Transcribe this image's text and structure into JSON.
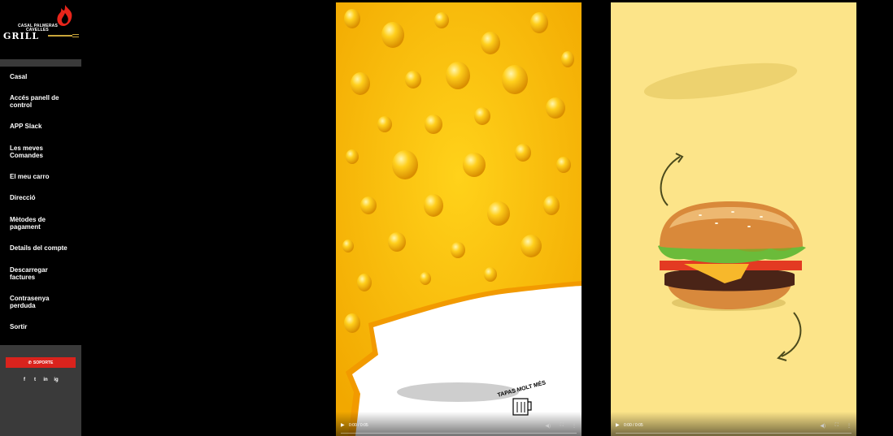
{
  "logo": {
    "line1": "CASAL PALMERAS",
    "line2": "CAVELLES",
    "grill": "GRILL"
  },
  "sidebar": {
    "items": [
      {
        "label": "Casal"
      },
      {
        "label": "Accés panell de control"
      },
      {
        "label": "APP Slack"
      },
      {
        "label": "Les meves Comandes"
      },
      {
        "label": "El meu carro"
      },
      {
        "label": "Direcció"
      },
      {
        "label": "Mètodes de pagament"
      },
      {
        "label": "Details del compte"
      },
      {
        "label": "Descarregar factures"
      },
      {
        "label": "Contrasenya perduda"
      },
      {
        "label": "Sortir"
      }
    ],
    "support_label": "SOPORTE",
    "socials": [
      "f",
      "t",
      "in",
      "ig"
    ]
  },
  "videos": [
    {
      "time": "0:00 / 0:05",
      "overlay_text": "TAPAS MOLT MÉS"
    },
    {
      "time": "0:00 / 0:05"
    }
  ],
  "colors": {
    "sidebar_bg": "#000000",
    "sidebar_panel": "#3a3a3a",
    "support_red": "#d9231d",
    "beer_yellow": "#f7b800",
    "burger_bg": "#fce489"
  }
}
